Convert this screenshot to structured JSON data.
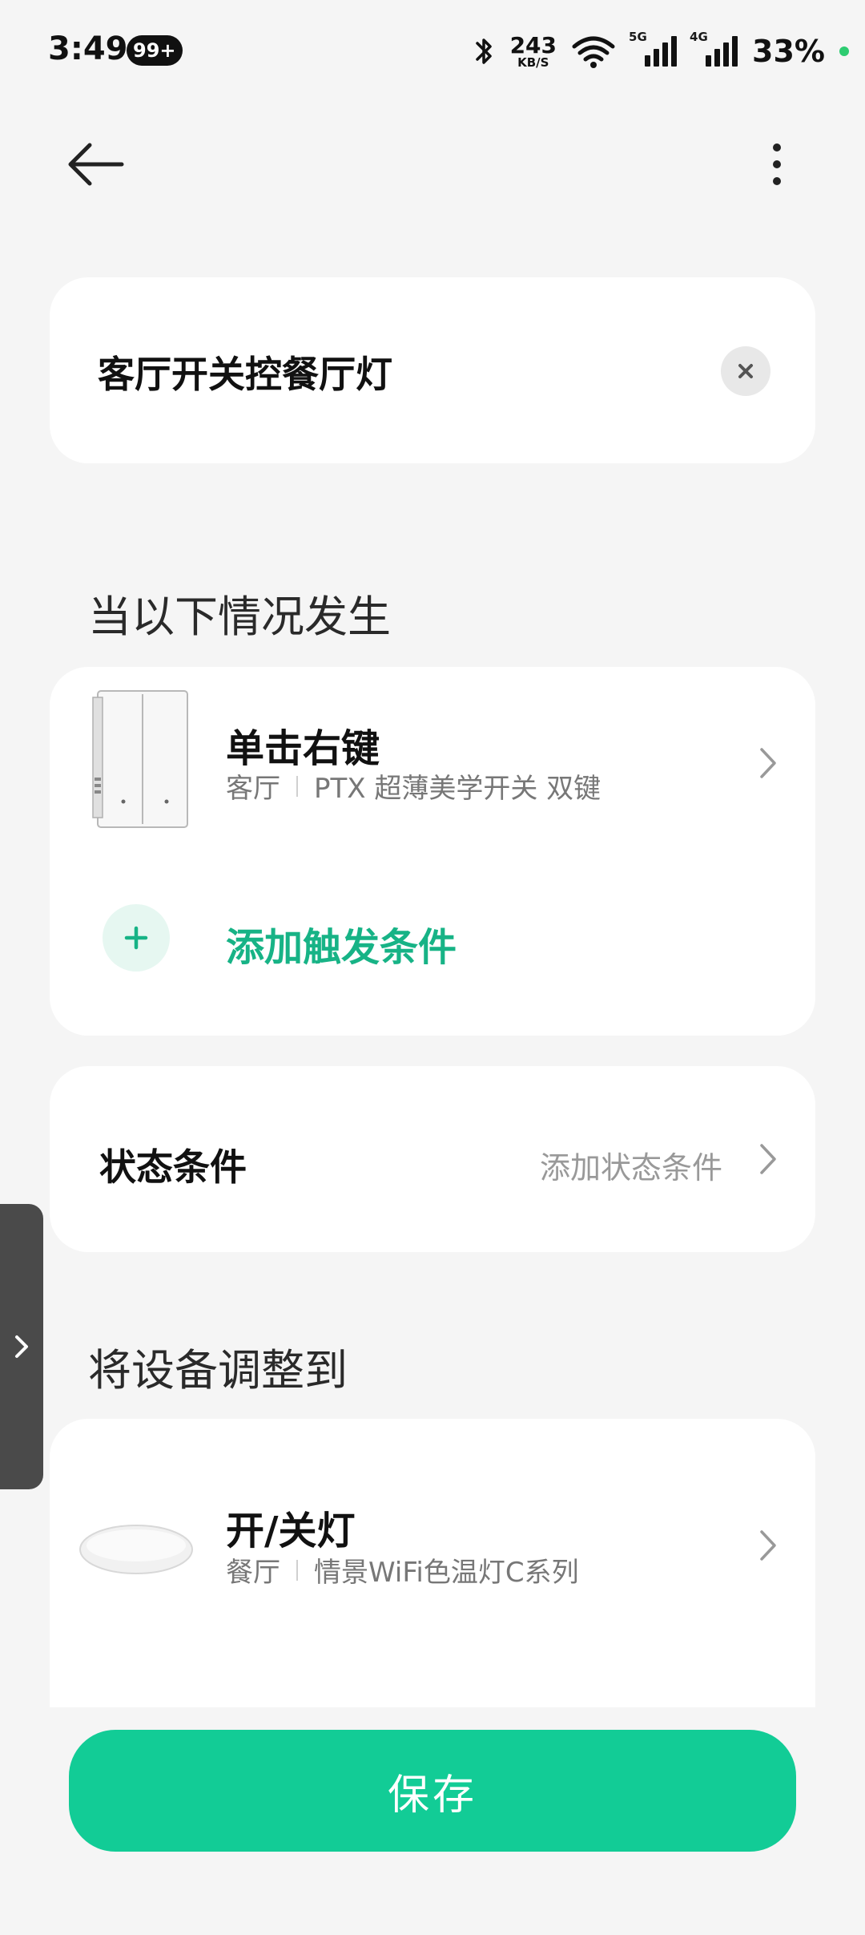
{
  "status_bar": {
    "time": "3:49",
    "notification_badge": "99+",
    "net_speed_value": "243",
    "net_speed_unit": "KB/S",
    "signal_1_label": "5G",
    "signal_2_label": "4G",
    "battery": "33%"
  },
  "header": {
    "back_icon": "back-arrow-icon",
    "more_icon": "more-vertical-icon"
  },
  "automation_name": {
    "value": "客厅开关控餐厅灯",
    "clear_icon": "close-icon"
  },
  "trigger_section": {
    "heading": "当以下情况发生",
    "trigger": {
      "title": "单击右键",
      "room": "客厅",
      "device": "PTX 超薄美学开关 双键"
    },
    "add_label": "添加触发条件"
  },
  "state_condition": {
    "title": "状态条件",
    "action": "添加状态条件"
  },
  "action_section": {
    "heading": "将设备调整到",
    "action": {
      "title": "开/关灯",
      "room": "餐厅",
      "device": "情景WiFi色温灯C系列"
    }
  },
  "save_button": "保存",
  "colors": {
    "accent": "#12cc96",
    "accent_text": "#17b386",
    "background": "#f5f5f5"
  }
}
